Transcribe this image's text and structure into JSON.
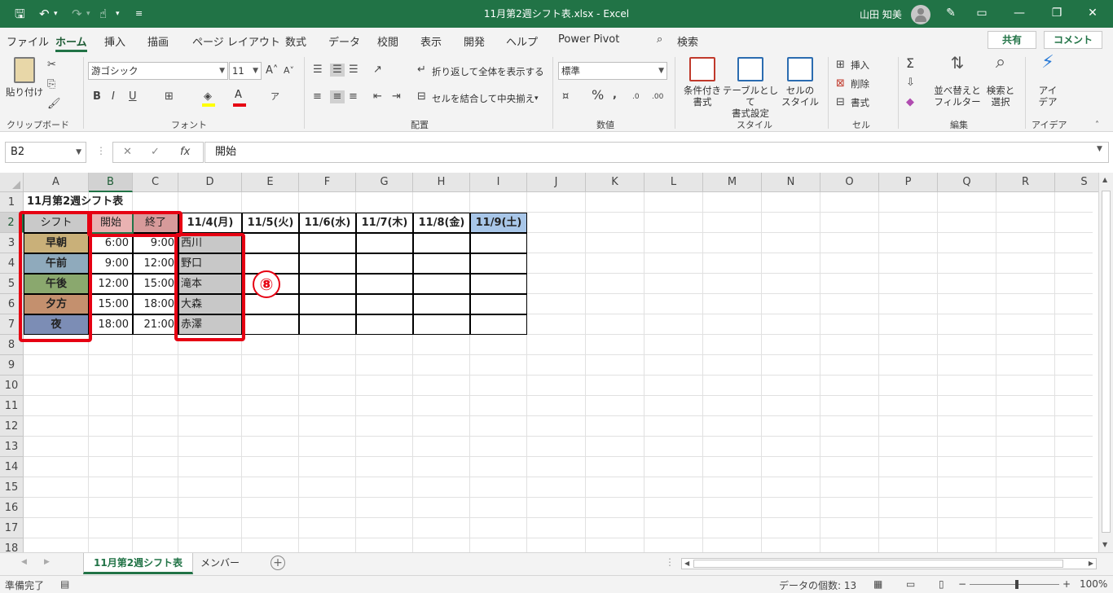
{
  "window": {
    "title": "11月第2週シフト表.xlsx  -  Excel",
    "user": "山田 知美"
  },
  "menu": {
    "tabs": [
      "ファイル",
      "ホーム",
      "挿入",
      "描画",
      "ページ レイアウト",
      "数式",
      "データ",
      "校閲",
      "表示",
      "開発",
      "ヘルプ",
      "Power Pivot",
      "検索"
    ],
    "share": "共有",
    "comment": "コメント"
  },
  "ribbon": {
    "paste": "貼り付け",
    "clipboard": "クリップボード",
    "font_name": "游ゴシック",
    "font_size": "11",
    "font_group": "フォント",
    "wrap_text": "折り返して全体を表示する",
    "merge_center": "セルを結合して中央揃え",
    "alignment_group": "配置",
    "number_format": "標準",
    "number_group": "数値",
    "cond_format_1": "条件付き",
    "cond_format_2": "書式",
    "as_table_1": "テーブルとして",
    "as_table_2": "書式設定",
    "cell_style_1": "セルの",
    "cell_style_2": "スタイル",
    "styles_group": "スタイル",
    "insert": "挿入",
    "delete": "削除",
    "format": "書式",
    "cells_group": "セル",
    "sort_1": "並べ替えと",
    "sort_2": "フィルター",
    "find_1": "検索と",
    "find_2": "選択",
    "edit_group": "編集",
    "ideas_1": "アイ",
    "ideas_2": "デア",
    "ideas_group": "アイデア"
  },
  "formula_bar": {
    "name_box": "B2",
    "value": "開始"
  },
  "columns": [
    "A",
    "B",
    "C",
    "D",
    "E",
    "F",
    "G",
    "H",
    "I",
    "J",
    "K",
    "L",
    "M",
    "N",
    "O",
    "P",
    "Q",
    "R",
    "S"
  ],
  "rows": [
    "1",
    "2",
    "3",
    "4",
    "5",
    "6",
    "7",
    "8",
    "9",
    "10",
    "11",
    "12",
    "13",
    "14",
    "15",
    "16",
    "17",
    "18"
  ],
  "sheet": {
    "title": "11月第2週シフト表",
    "shift_header": "シフト",
    "start_header": "開始",
    "end_header": "終了",
    "dates": [
      "11/4(月)",
      "11/5(火)",
      "11/6(水)",
      "11/7(木)",
      "11/8(金)",
      "11/9(土)"
    ],
    "shifts": [
      {
        "name": "早朝",
        "start": "6:00",
        "end": "9:00",
        "person": "西川",
        "color": "#c9b079"
      },
      {
        "name": "午前",
        "start": "9:00",
        "end": "12:00",
        "person": "野口",
        "color": "#8faabc"
      },
      {
        "name": "午後",
        "start": "12:00",
        "end": "15:00",
        "person": "滝本",
        "color": "#8aa86e"
      },
      {
        "name": "夕方",
        "start": "15:00",
        "end": "18:00",
        "person": "大森",
        "color": "#c4906e"
      },
      {
        "name": "夜",
        "start": "18:00",
        "end": "21:00",
        "person": "赤澤",
        "color": "#7c8db5"
      }
    ]
  },
  "annotation": {
    "badge": "⑧"
  },
  "tabs": [
    "11月第2週シフト表",
    "メンバー"
  ],
  "status": {
    "ready": "準備完了",
    "count": "データの個数: 13",
    "zoom": "100%"
  }
}
